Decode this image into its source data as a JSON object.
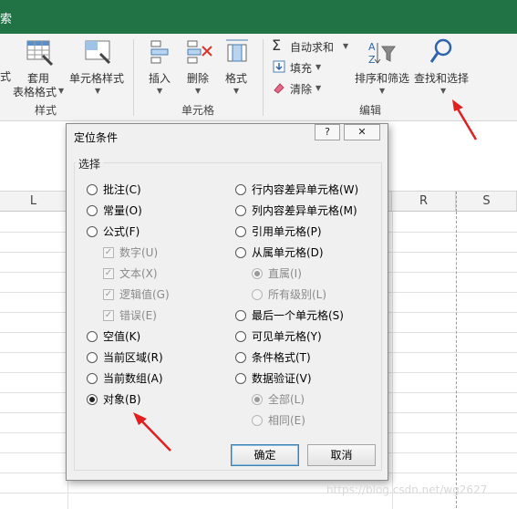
{
  "title": {
    "partial": "索"
  },
  "ribbon": {
    "style_partial": "式",
    "apply_table": [
      "套用",
      "表格格式"
    ],
    "cell_styles": "单元格样式",
    "styles_group": "样式",
    "insert": "插入",
    "delete": "删除",
    "format": "格式",
    "cells_group": "单元格",
    "autosum": "自动求和",
    "fill": "填充",
    "clear": "清除",
    "sort_filter": "排序和筛选",
    "find_select": "查找和选择",
    "editing_group": "编辑"
  },
  "sheet": {
    "columns": [
      "L",
      "R",
      "S"
    ]
  },
  "dialog": {
    "title": "定位条件",
    "help": "?",
    "close": "✕",
    "group": "选择",
    "left_options": [
      {
        "label": "批注(C)",
        "selected": false,
        "disabled": false,
        "type": "radio"
      },
      {
        "label": "常量(O)",
        "selected": false,
        "disabled": false,
        "type": "radio"
      },
      {
        "label": "公式(F)",
        "selected": false,
        "disabled": false,
        "type": "radio"
      },
      {
        "label": "数字(U)",
        "checked": true,
        "disabled": true,
        "type": "check"
      },
      {
        "label": "文本(X)",
        "checked": true,
        "disabled": true,
        "type": "check"
      },
      {
        "label": "逻辑值(G)",
        "checked": true,
        "disabled": true,
        "type": "check"
      },
      {
        "label": "错误(E)",
        "checked": true,
        "disabled": true,
        "type": "check"
      },
      {
        "label": "空值(K)",
        "selected": false,
        "disabled": false,
        "type": "radio"
      },
      {
        "label": "当前区域(R)",
        "selected": false,
        "disabled": false,
        "type": "radio"
      },
      {
        "label": "当前数组(A)",
        "selected": false,
        "disabled": false,
        "type": "radio"
      },
      {
        "label": "对象(B)",
        "selected": true,
        "disabled": false,
        "type": "radio"
      }
    ],
    "right_options": [
      {
        "label": "行内容差异单元格(W)",
        "selected": false,
        "disabled": false
      },
      {
        "label": "列内容差异单元格(M)",
        "selected": false,
        "disabled": false
      },
      {
        "label": "引用单元格(P)",
        "selected": false,
        "disabled": false
      },
      {
        "label": "从属单元格(D)",
        "selected": false,
        "disabled": false
      },
      {
        "label": "直属(I)",
        "selected": true,
        "disabled": true
      },
      {
        "label": "所有级别(L)",
        "selected": false,
        "disabled": true
      },
      {
        "label": "最后一个单元格(S)",
        "selected": false,
        "disabled": false
      },
      {
        "label": "可见单元格(Y)",
        "selected": false,
        "disabled": false
      },
      {
        "label": "条件格式(T)",
        "selected": false,
        "disabled": false
      },
      {
        "label": "数据验证(V)",
        "selected": false,
        "disabled": false
      },
      {
        "label": "全部(L)",
        "selected": true,
        "disabled": true
      },
      {
        "label": "相同(E)",
        "selected": false,
        "disabled": true
      }
    ],
    "ok": "确定",
    "cancel": "取消"
  },
  "watermark": "https://blog.csdn.net/wg2627",
  "colors": {
    "title_bar": "#217346",
    "annotation_arrow": "#e02020"
  }
}
